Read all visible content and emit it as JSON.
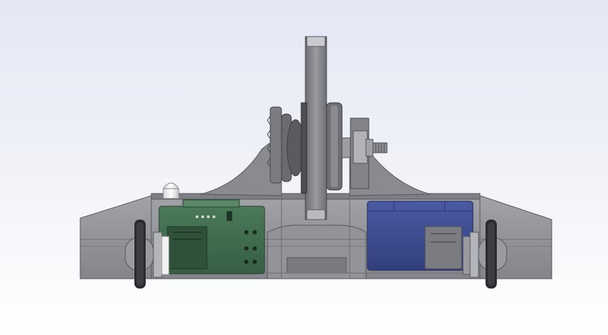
{
  "view": {
    "background_top": "#e4e7f4",
    "background_bottom": "#ffffff"
  },
  "model": {
    "body_color": "#8e8f95",
    "body_dark": "#5c5d62",
    "weapon_disc_color": "#7d7e84",
    "pcb_color": "#3f6a4c",
    "battery_color": "#3c4a8c",
    "wheel_color": "#2a2b2e",
    "led_color": "#f2f2f2",
    "bolt_color": "#aeb0b4"
  }
}
